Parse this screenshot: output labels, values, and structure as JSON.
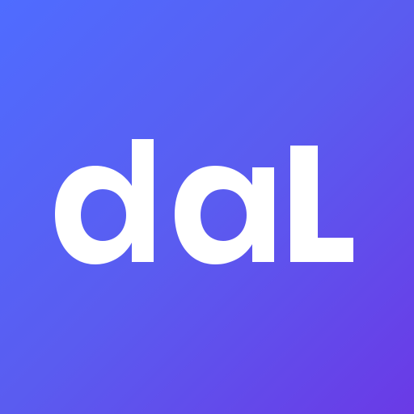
{
  "app_icon": {
    "wordmark": "daL",
    "colors": {
      "gradient_start": "#4f6cff",
      "gradient_mid": "#5a5cf0",
      "gradient_end": "#6a3ae6",
      "glyph": "#ffffff"
    }
  }
}
